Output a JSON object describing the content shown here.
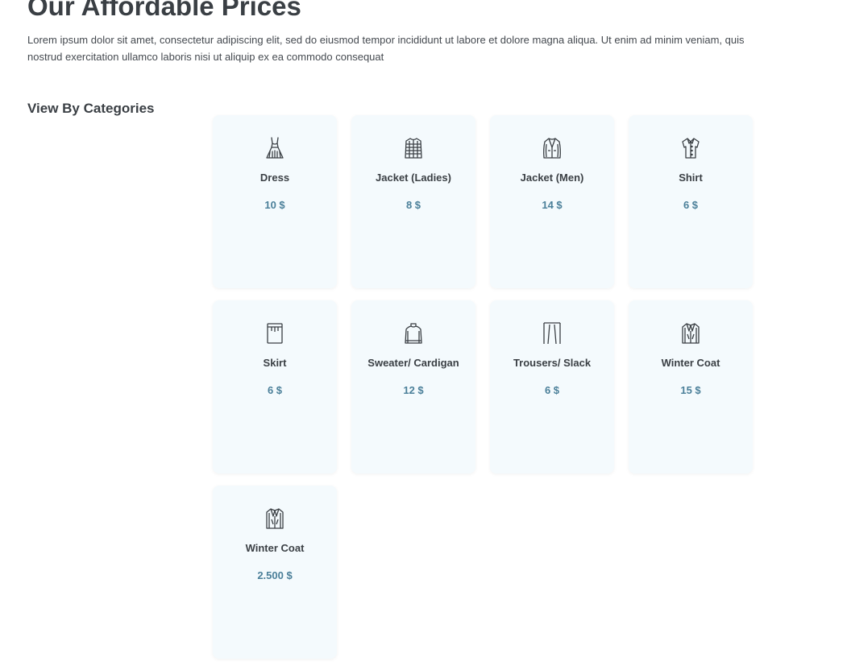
{
  "header": {
    "title": "Our Affordable Prices",
    "intro": "Lorem ipsum dolor sit amet, consectetur adipiscing elit, sed do eiusmod tempor incididunt ut labore et dolore magna aliqua. Ut enim ad minim veniam, quis nostrud exercitation ullamco laboris nisi ut aliquip ex ea commodo consequat"
  },
  "categories": {
    "heading": "View By Categories",
    "items": [
      {
        "name": "Dress",
        "price": "10 $",
        "icon": "dress-icon"
      },
      {
        "name": "Jacket (Ladies)",
        "price": "8 $",
        "icon": "ladies-jacket-icon"
      },
      {
        "name": "Jacket (Men)",
        "price": "14 $",
        "icon": "mens-jacket-icon"
      },
      {
        "name": "Shirt",
        "price": "6 $",
        "icon": "shirt-icon"
      },
      {
        "name": "Skirt",
        "price": "6 $",
        "icon": "skirt-icon"
      },
      {
        "name": "Sweater/ Cardigan",
        "price": "12 $",
        "icon": "sweater-icon"
      },
      {
        "name": "Trousers/ Slack",
        "price": "6 $",
        "icon": "trousers-icon"
      },
      {
        "name": "Winter Coat",
        "price": "15 $",
        "icon": "winter-coat-icon"
      },
      {
        "name": "Winter Coat",
        "price": "2.500 $",
        "icon": "winter-coat-icon"
      }
    ]
  },
  "colors": {
    "card_background": "#f4fafd",
    "price_accent": "#4a7f99",
    "heading_text": "#3a3f44"
  }
}
